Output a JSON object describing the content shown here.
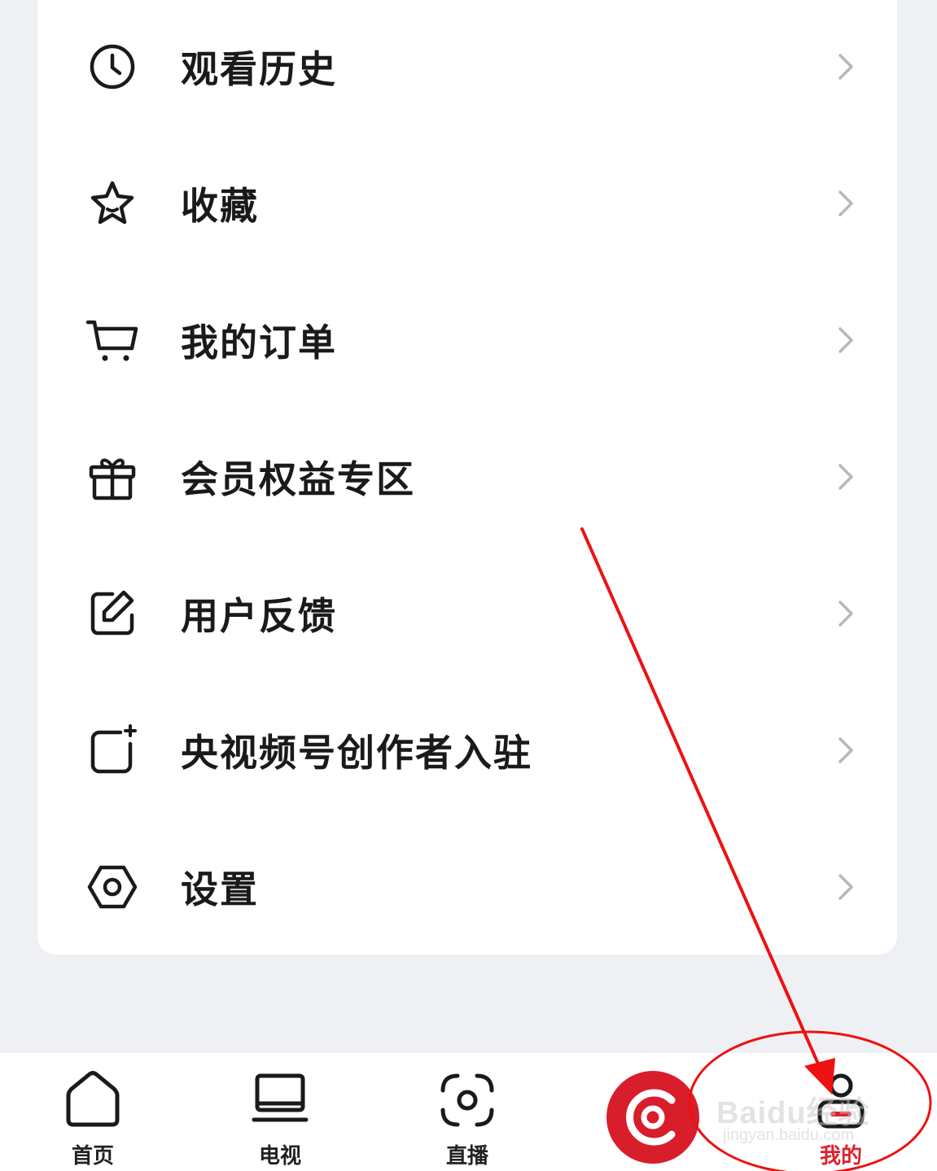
{
  "menu": {
    "items": [
      {
        "label": "观看历史",
        "icon": "clock-icon"
      },
      {
        "label": "收藏",
        "icon": "star-icon"
      },
      {
        "label": "我的订单",
        "icon": "cart-icon"
      },
      {
        "label": "会员权益专区",
        "icon": "gift-icon"
      },
      {
        "label": "用户反馈",
        "icon": "edit-icon"
      },
      {
        "label": "央视频号创作者入驻",
        "icon": "square-plus-icon"
      },
      {
        "label": "设置",
        "icon": "hexagon-settings-icon"
      }
    ]
  },
  "tabbar": {
    "items": [
      {
        "label": "首页",
        "icon": "home-icon"
      },
      {
        "label": "电视",
        "icon": "tv-icon"
      },
      {
        "label": "直播",
        "icon": "live-scan-icon"
      },
      {
        "label": "我的",
        "icon": "user-icon",
        "active": true
      }
    ],
    "center_icon": "cctv-logo-icon"
  },
  "watermark": {
    "brand": "Baidu经验",
    "url": "jingyan.baidu.com"
  },
  "colors": {
    "page_background": "#eef0f4",
    "card_background": "#ffffff",
    "text_primary": "#1a1a1a",
    "chevron": "#b8b8b8",
    "accent_red": "#e0202e",
    "center_button": "#d81e2a",
    "annotation_red": "#ee1111"
  }
}
